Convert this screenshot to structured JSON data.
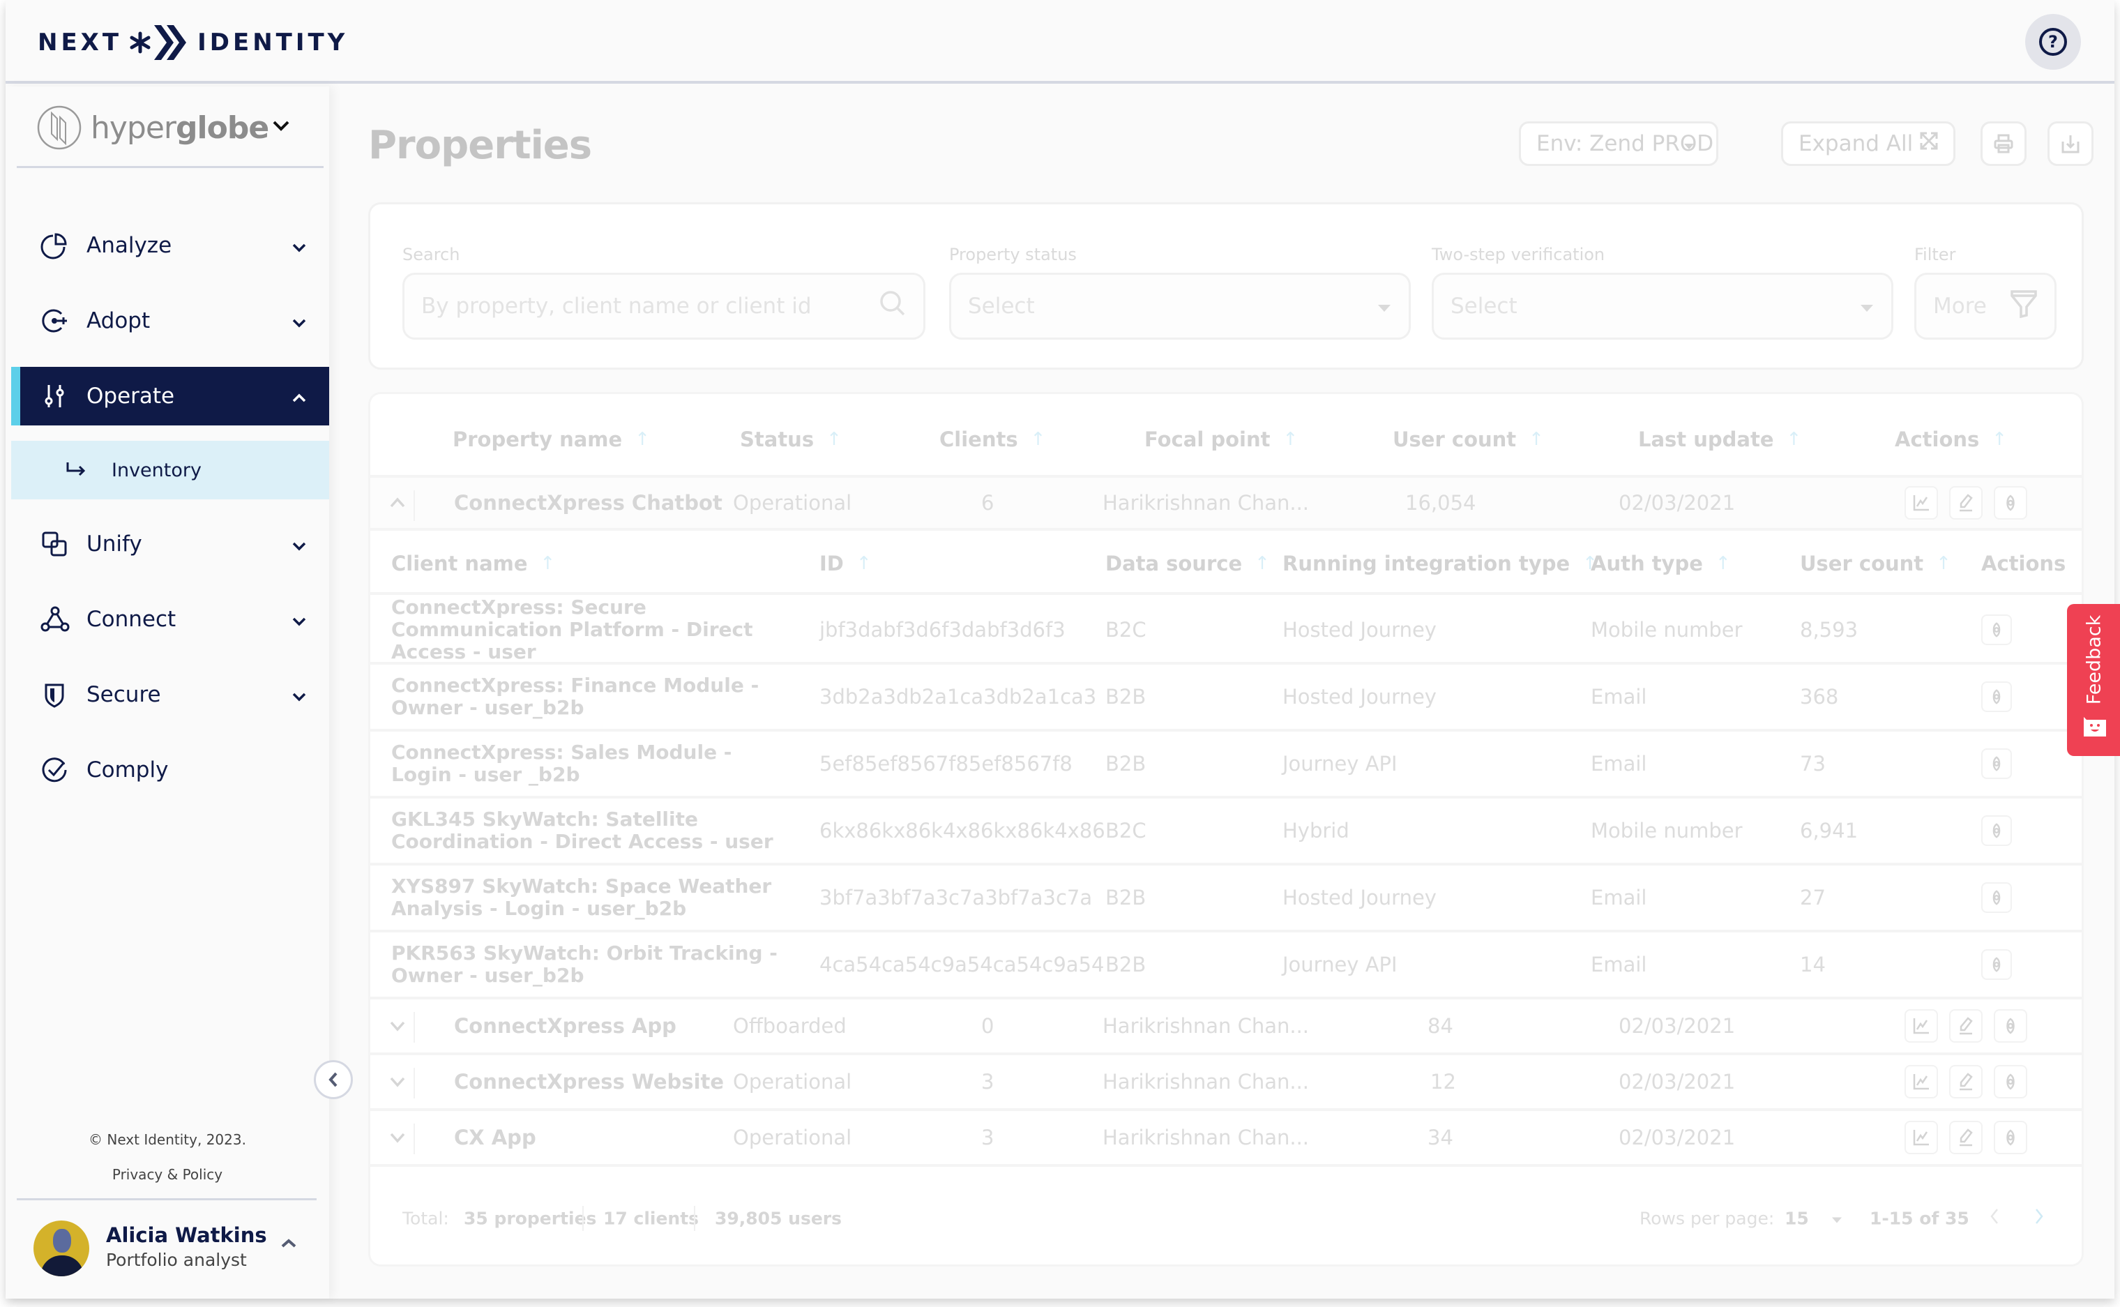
{
  "header": {
    "logo_left": "NEXT",
    "logo_right": "IDENTITY",
    "help_icon": "question-circle-icon"
  },
  "sidebar": {
    "brand_light": "hyper",
    "brand_bold": "globe",
    "items": [
      {
        "label": "Analyze",
        "icon": "pie-chart-icon"
      },
      {
        "label": "Adopt",
        "icon": "adopt-icon"
      },
      {
        "label": "Operate",
        "icon": "sliders-icon",
        "active": true
      },
      {
        "label": "Unify",
        "icon": "overlap-squares-icon"
      },
      {
        "label": "Connect",
        "icon": "nodes-icon"
      },
      {
        "label": "Secure",
        "icon": "shield-icon"
      },
      {
        "label": "Comply",
        "icon": "check-circle-icon"
      }
    ],
    "sub_item": {
      "label": "Inventory",
      "icon": "arrow-return-right-icon"
    },
    "copyright": "© Next Identity, 2023.",
    "privacy": "Privacy & Policy",
    "user": {
      "name": "Alicia Watkins",
      "role": "Portfolio analyst"
    }
  },
  "main": {
    "title": "Properties",
    "env_button": "Env: Zend PROD",
    "expand_button": "Expand All",
    "filters": {
      "search_label": "Search",
      "search_placeholder": "By property, client name or client id",
      "status_label": "Property status",
      "status_value": "Select",
      "twostep_label": "Two-step verification",
      "twostep_value": "Select",
      "filter_label": "Filter",
      "more_label": "More"
    },
    "columns": [
      "Property name",
      "Status",
      "Clients",
      "Focal point",
      "User count",
      "Last update",
      "Actions"
    ],
    "client_columns": [
      "Client name",
      "ID",
      "Data source",
      "Running integration type",
      "Auth type",
      "User count",
      "Actions"
    ],
    "properties": [
      {
        "name": "ConnectXpress Chatbot",
        "status": "Operational",
        "clients": "6",
        "focal": "Harikrishnan Chan...",
        "users": "16,054",
        "updated": "02/03/2021",
        "expanded": true
      },
      {
        "name": "ConnectXpress App",
        "status": "Offboarded",
        "clients": "0",
        "focal": "Harikrishnan Chan...",
        "users": "84",
        "updated": "02/03/2021"
      },
      {
        "name": "ConnectXpress Website",
        "status": "Operational",
        "clients": "3",
        "focal": "Harikrishnan Chan...",
        "users": "12",
        "updated": "02/03/2021"
      },
      {
        "name": "CX App",
        "status": "Operational",
        "clients": "3",
        "focal": "Harikrishnan Chan...",
        "users": "34",
        "updated": "02/03/2021"
      }
    ],
    "clients": [
      {
        "name": "ConnectXpress: Secure Communication Platform - Direct Access - user",
        "id": "jbf3dabf3d6f3dabf3d6f3",
        "source": "B2C",
        "integration": "Hosted Journey",
        "auth": "Mobile number",
        "users": "8,593"
      },
      {
        "name": "ConnectXpress: Finance Module - Owner - user_b2b",
        "id": "3db2a3db2a1ca3db2a1ca3",
        "source": "B2B",
        "integration": "Hosted Journey",
        "auth": "Email",
        "users": "368"
      },
      {
        "name": "ConnectXpress: Sales Module - Login - user _b2b",
        "id": "5ef85ef8567f85ef8567f8",
        "source": "B2B",
        "integration": "Journey API",
        "auth": "Email",
        "users": "73"
      },
      {
        "name": "GKL345 SkyWatch: Satellite Coordination - Direct Access - user",
        "id": "6kx86kx86k4x86kx86k4x86",
        "source": "B2C",
        "integration": "Hybrid",
        "auth": "Mobile number",
        "users": "6,941"
      },
      {
        "name": "XYS897 SkyWatch: Space Weather Analysis - Login - user_b2b",
        "id": "3bf7a3bf7a3c7a3bf7a3c7a",
        "source": "B2B",
        "integration": "Hosted Journey",
        "auth": "Email",
        "users": "27"
      },
      {
        "name": "PKR563 SkyWatch: Orbit Tracking - Owner - user_b2b",
        "id": "4ca54ca54c9a54ca54c9a54",
        "source": "B2B",
        "integration": "Journey API",
        "auth": "Email",
        "users": "14"
      }
    ],
    "footer": {
      "total_label": "Total:",
      "properties": "35 properties",
      "clients": "17 clients",
      "users": "39,805 users",
      "rows_label": "Rows per page:",
      "rows_value": "15",
      "range": "1-15 of 35"
    }
  },
  "feedback": {
    "label": "Feedback"
  },
  "colors": {
    "brand_navy": "#0f1a47",
    "active_accent": "#5dcfe9",
    "sub_item_bg": "#dcf0f8",
    "feedback_red": "#ef4153"
  }
}
